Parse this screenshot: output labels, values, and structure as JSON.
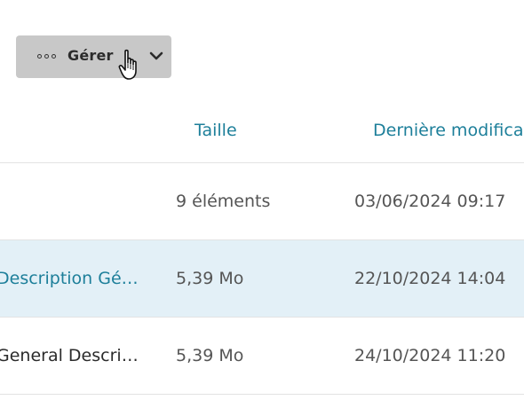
{
  "toolbar": {
    "manage_label": "Gérer"
  },
  "table": {
    "columns": {
      "size": "Taille",
      "modified": "Dernière modifica"
    },
    "rows": [
      {
        "name": "",
        "size": "9 éléments",
        "modified": "03/06/2024 09:17"
      },
      {
        "name": "Description Gén…",
        "size": "5,39 Mo",
        "modified": "22/10/2024 14:04"
      },
      {
        "name": "General Descript…",
        "size": "5,39 Mo",
        "modified": "24/10/2024 11:20"
      }
    ]
  }
}
